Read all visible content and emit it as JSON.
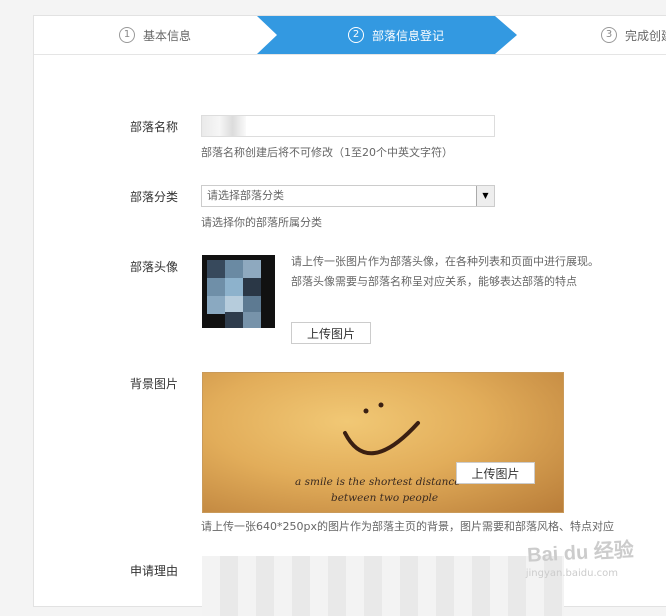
{
  "stepper": {
    "steps": [
      {
        "num": "1",
        "label": "基本信息"
      },
      {
        "num": "2",
        "label": "部落信息登记"
      },
      {
        "num": "3",
        "label": "完成创建"
      }
    ]
  },
  "form": {
    "name": {
      "label": "部落名称",
      "value": "落",
      "hint": "部落名称创建后将不可修改（1至20个中英文字符）"
    },
    "category": {
      "label": "部落分类",
      "selected": "请选择部落分类",
      "hint": "请选择你的部落所属分类"
    },
    "avatar": {
      "label": "部落头像",
      "description": "请上传一张图片作为部落头像，在各种列表和页面中进行展现。部落头像需要与部落名称呈对应关系，能够表达部落的特点",
      "upload_label": "上传图片"
    },
    "background": {
      "label": "背景图片",
      "upload_label": "上传图片",
      "hint": "请上传一张640*250px的图片作为部落主页的背景，图片需要和部落风格、特点对应",
      "image_text_line1": "a smile is the shortest distance",
      "image_text_line2": "between two people"
    },
    "reason": {
      "label": "申请理由"
    }
  },
  "watermark": {
    "brand": "Bai du 经验",
    "url": "jingyan.baidu.com"
  },
  "colors": {
    "accent": "#3399e1"
  }
}
